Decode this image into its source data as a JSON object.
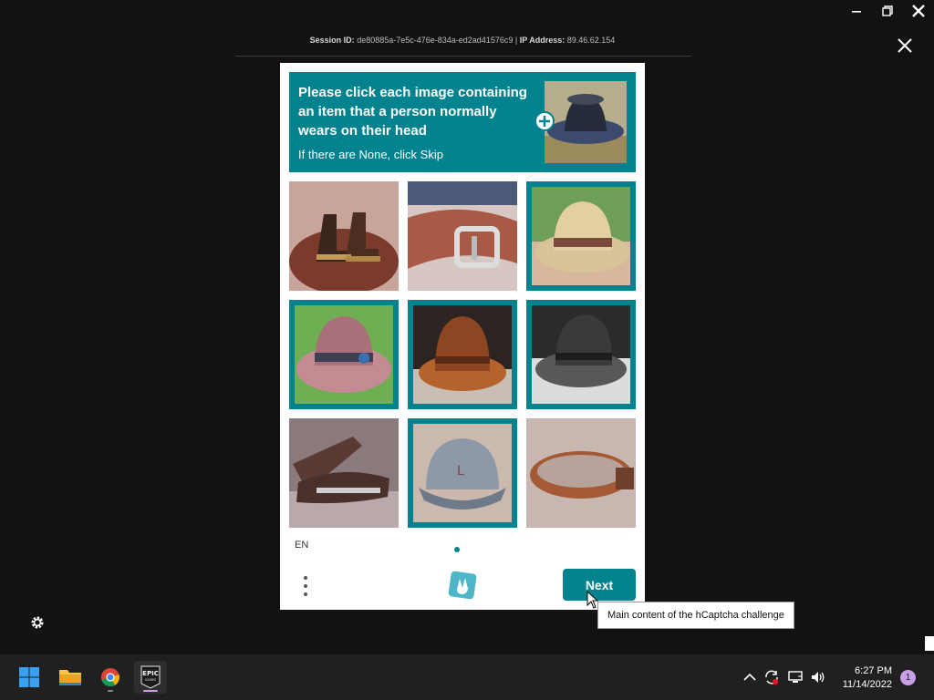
{
  "session": {
    "id_label": "Session ID:",
    "id_value": "de80885a-7e5c-476e-834a-ed2ad41576c9",
    "separator": "|",
    "ip_label": "IP Address:",
    "ip_value": "89.46.62.154"
  },
  "captcha": {
    "prompt_title": "Please click each image containing an item that a person normally wears on their head",
    "prompt_sub": "If there are None, click Skip",
    "language": "EN",
    "next_label": "Next",
    "accent_color": "#00838f",
    "tiles": [
      {
        "subject": "boots-icon",
        "selected": false
      },
      {
        "subject": "belt-icon",
        "selected": false
      },
      {
        "subject": "hat-icon",
        "selected": true
      },
      {
        "subject": "hat-icon",
        "selected": true
      },
      {
        "subject": "hat-icon",
        "selected": true
      },
      {
        "subject": "hat-icon",
        "selected": true
      },
      {
        "subject": "shoe-icon",
        "selected": false
      },
      {
        "subject": "cap-icon",
        "selected": true
      },
      {
        "subject": "belt-icon",
        "selected": false
      }
    ]
  },
  "tooltip": "Main content of the hCaptcha challenge",
  "taskbar": {
    "apps": [
      "windows-start-icon",
      "file-explorer-icon",
      "chrome-icon",
      "epic-games-icon"
    ],
    "epic_label_top": "EPIC",
    "epic_label_bottom": "GAMES",
    "time": "6:27 PM",
    "date": "11/14/2022",
    "notification_count": "1"
  }
}
